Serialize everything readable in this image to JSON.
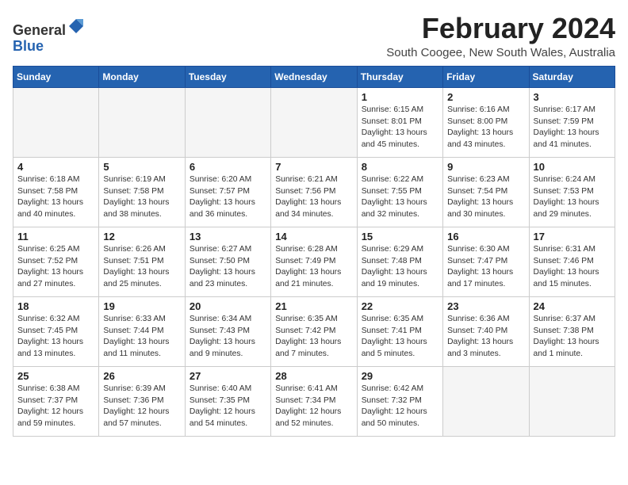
{
  "header": {
    "logo_line1": "General",
    "logo_line2": "Blue",
    "month_title": "February 2024",
    "location": "South Coogee, New South Wales, Australia"
  },
  "days_of_week": [
    "Sunday",
    "Monday",
    "Tuesday",
    "Wednesday",
    "Thursday",
    "Friday",
    "Saturday"
  ],
  "weeks": [
    [
      {
        "day": "",
        "info": ""
      },
      {
        "day": "",
        "info": ""
      },
      {
        "day": "",
        "info": ""
      },
      {
        "day": "",
        "info": ""
      },
      {
        "day": "1",
        "info": "Sunrise: 6:15 AM\nSunset: 8:01 PM\nDaylight: 13 hours\nand 45 minutes."
      },
      {
        "day": "2",
        "info": "Sunrise: 6:16 AM\nSunset: 8:00 PM\nDaylight: 13 hours\nand 43 minutes."
      },
      {
        "day": "3",
        "info": "Sunrise: 6:17 AM\nSunset: 7:59 PM\nDaylight: 13 hours\nand 41 minutes."
      }
    ],
    [
      {
        "day": "4",
        "info": "Sunrise: 6:18 AM\nSunset: 7:58 PM\nDaylight: 13 hours\nand 40 minutes."
      },
      {
        "day": "5",
        "info": "Sunrise: 6:19 AM\nSunset: 7:58 PM\nDaylight: 13 hours\nand 38 minutes."
      },
      {
        "day": "6",
        "info": "Sunrise: 6:20 AM\nSunset: 7:57 PM\nDaylight: 13 hours\nand 36 minutes."
      },
      {
        "day": "7",
        "info": "Sunrise: 6:21 AM\nSunset: 7:56 PM\nDaylight: 13 hours\nand 34 minutes."
      },
      {
        "day": "8",
        "info": "Sunrise: 6:22 AM\nSunset: 7:55 PM\nDaylight: 13 hours\nand 32 minutes."
      },
      {
        "day": "9",
        "info": "Sunrise: 6:23 AM\nSunset: 7:54 PM\nDaylight: 13 hours\nand 30 minutes."
      },
      {
        "day": "10",
        "info": "Sunrise: 6:24 AM\nSunset: 7:53 PM\nDaylight: 13 hours\nand 29 minutes."
      }
    ],
    [
      {
        "day": "11",
        "info": "Sunrise: 6:25 AM\nSunset: 7:52 PM\nDaylight: 13 hours\nand 27 minutes."
      },
      {
        "day": "12",
        "info": "Sunrise: 6:26 AM\nSunset: 7:51 PM\nDaylight: 13 hours\nand 25 minutes."
      },
      {
        "day": "13",
        "info": "Sunrise: 6:27 AM\nSunset: 7:50 PM\nDaylight: 13 hours\nand 23 minutes."
      },
      {
        "day": "14",
        "info": "Sunrise: 6:28 AM\nSunset: 7:49 PM\nDaylight: 13 hours\nand 21 minutes."
      },
      {
        "day": "15",
        "info": "Sunrise: 6:29 AM\nSunset: 7:48 PM\nDaylight: 13 hours\nand 19 minutes."
      },
      {
        "day": "16",
        "info": "Sunrise: 6:30 AM\nSunset: 7:47 PM\nDaylight: 13 hours\nand 17 minutes."
      },
      {
        "day": "17",
        "info": "Sunrise: 6:31 AM\nSunset: 7:46 PM\nDaylight: 13 hours\nand 15 minutes."
      }
    ],
    [
      {
        "day": "18",
        "info": "Sunrise: 6:32 AM\nSunset: 7:45 PM\nDaylight: 13 hours\nand 13 minutes."
      },
      {
        "day": "19",
        "info": "Sunrise: 6:33 AM\nSunset: 7:44 PM\nDaylight: 13 hours\nand 11 minutes."
      },
      {
        "day": "20",
        "info": "Sunrise: 6:34 AM\nSunset: 7:43 PM\nDaylight: 13 hours\nand 9 minutes."
      },
      {
        "day": "21",
        "info": "Sunrise: 6:35 AM\nSunset: 7:42 PM\nDaylight: 13 hours\nand 7 minutes."
      },
      {
        "day": "22",
        "info": "Sunrise: 6:35 AM\nSunset: 7:41 PM\nDaylight: 13 hours\nand 5 minutes."
      },
      {
        "day": "23",
        "info": "Sunrise: 6:36 AM\nSunset: 7:40 PM\nDaylight: 13 hours\nand 3 minutes."
      },
      {
        "day": "24",
        "info": "Sunrise: 6:37 AM\nSunset: 7:38 PM\nDaylight: 13 hours\nand 1 minute."
      }
    ],
    [
      {
        "day": "25",
        "info": "Sunrise: 6:38 AM\nSunset: 7:37 PM\nDaylight: 12 hours\nand 59 minutes."
      },
      {
        "day": "26",
        "info": "Sunrise: 6:39 AM\nSunset: 7:36 PM\nDaylight: 12 hours\nand 57 minutes."
      },
      {
        "day": "27",
        "info": "Sunrise: 6:40 AM\nSunset: 7:35 PM\nDaylight: 12 hours\nand 54 minutes."
      },
      {
        "day": "28",
        "info": "Sunrise: 6:41 AM\nSunset: 7:34 PM\nDaylight: 12 hours\nand 52 minutes."
      },
      {
        "day": "29",
        "info": "Sunrise: 6:42 AM\nSunset: 7:32 PM\nDaylight: 12 hours\nand 50 minutes."
      },
      {
        "day": "",
        "info": ""
      },
      {
        "day": "",
        "info": ""
      }
    ]
  ]
}
